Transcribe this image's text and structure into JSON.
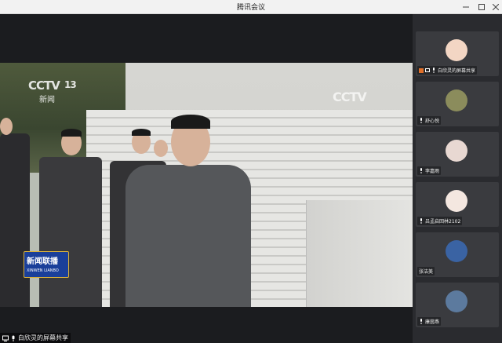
{
  "window": {
    "title": "腾讯会议"
  },
  "video": {
    "logo_main": "CCTV",
    "logo_number": "13",
    "logo_sub": "新闻",
    "logo_right": "CCTV",
    "badge_title": "新闻联播",
    "badge_sub": "XINWEN LIANBO"
  },
  "share_label": "白欣灵的屏幕共享",
  "participants": [
    {
      "name": "白欣灵的屏幕共享",
      "avatar_color": "#f3d6c4"
    },
    {
      "name": "舒心悦",
      "avatar_color": "#8b8c5c"
    },
    {
      "name": "李嘉雨",
      "avatar_color": "#e8d8d2"
    },
    {
      "name": "吕孟启回林2102",
      "avatar_color": "#f4e7e0"
    },
    {
      "name": "张洁美",
      "avatar_color": "#3a63a3"
    },
    {
      "name": "康茵燕",
      "avatar_color": "#5c7a9e"
    }
  ]
}
